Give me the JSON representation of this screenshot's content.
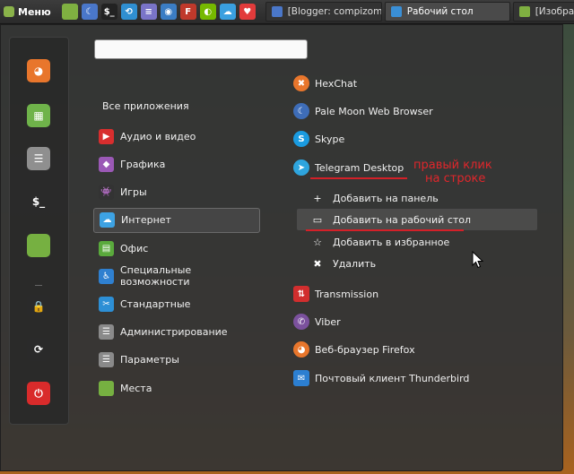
{
  "panel": {
    "menu_label": "Меню",
    "launchers": [
      {
        "icon": "folder-icon",
        "color": "#7fb041",
        "glyph": ""
      },
      {
        "icon": "pale-moon-icon",
        "color": "#4a77c9",
        "glyph": "☾"
      },
      {
        "icon": "terminal-icon",
        "color": "#222222",
        "glyph": "$_"
      },
      {
        "icon": "settings-icon",
        "color": "#2f8fd1",
        "glyph": "⟲"
      },
      {
        "icon": "notes-icon",
        "color": "#7a74c8",
        "glyph": "≡"
      },
      {
        "icon": "screenshot-icon",
        "color": "#3b7dc4",
        "glyph": "◉"
      },
      {
        "icon": "app-red-icon",
        "color": "#c0392b",
        "glyph": "F"
      },
      {
        "icon": "nvidia-icon",
        "color": "#76b900",
        "glyph": "◐"
      },
      {
        "icon": "weather-icon",
        "color": "#3aa0e0",
        "glyph": "☁"
      },
      {
        "icon": "heart-icon",
        "color": "#e23b3b",
        "glyph": "♥"
      }
    ],
    "tasks": [
      {
        "label": "[Blogger: compizoma…",
        "icon_color": "#4a77c9",
        "active": false
      },
      {
        "label": "Рабочий стол",
        "icon_color": "#3a8fd6",
        "active": true
      },
      {
        "label": "[Изобра",
        "icon_color": "#7fb041",
        "active": false
      }
    ]
  },
  "favorites": [
    {
      "icon": "firefox-icon",
      "color": "#e8762c",
      "glyph": "◕"
    },
    {
      "icon": "software-manager-icon",
      "color": "#6fb34a",
      "glyph": "▦"
    },
    {
      "icon": "settings-toggle-icon",
      "color": "#8f8f8f",
      "glyph": "☰"
    },
    {
      "icon": "terminal-icon",
      "color": "#2a2a2a",
      "glyph": "$_"
    },
    {
      "icon": "files-folder-icon",
      "color": "#76b041",
      "glyph": ""
    },
    {
      "icon": "lock-icon",
      "color": "#2a2a2a",
      "glyph": "🔒"
    },
    {
      "icon": "logout-icon",
      "color": "#2a2a2a",
      "glyph": "⟳"
    },
    {
      "icon": "power-icon",
      "color": "#d92b2b",
      "glyph": "⏻"
    }
  ],
  "search": {
    "value": "",
    "placeholder": ""
  },
  "categories_all": "Все приложения",
  "categories": [
    {
      "label": "Аудио и видео",
      "icon": "audio-video-icon",
      "color": "#d82e2e",
      "glyph": "▶",
      "selected": false
    },
    {
      "label": "Графика",
      "icon": "graphics-icon",
      "color": "#9b59b6",
      "glyph": "◆",
      "selected": false
    },
    {
      "label": "Игры",
      "icon": "games-icon",
      "color": "#333333",
      "glyph": "👾",
      "selected": false
    },
    {
      "label": "Интернет",
      "icon": "internet-icon",
      "color": "#3da2e3",
      "glyph": "☁",
      "selected": true
    },
    {
      "label": "Офис",
      "icon": "office-icon",
      "color": "#5aaa3c",
      "glyph": "▤",
      "selected": false
    },
    {
      "label": "Специальные возможности",
      "icon": "accessibility-icon",
      "color": "#2f80d0",
      "glyph": "♿",
      "selected": false
    },
    {
      "label": "Стандартные",
      "icon": "accessories-icon",
      "color": "#2d8fd5",
      "glyph": "✂",
      "selected": false
    },
    {
      "label": "Администрирование",
      "icon": "administration-icon",
      "color": "#8a8a8a",
      "glyph": "☰",
      "selected": false
    },
    {
      "label": "Параметры",
      "icon": "preferences-icon",
      "color": "#8a8a8a",
      "glyph": "☰",
      "selected": false
    },
    {
      "label": "Места",
      "icon": "places-folder-icon",
      "color": "#76b041",
      "glyph": "",
      "selected": false
    }
  ],
  "apps_top": [
    {
      "label": "HexChat",
      "icon": "hexchat-icon",
      "color": "#e8762c",
      "glyph": "✖"
    },
    {
      "label": "Pale Moon Web Browser",
      "icon": "pale-moon-icon",
      "color": "#3e6db8",
      "glyph": "☾"
    },
    {
      "label": "Skype",
      "icon": "skype-icon",
      "color": "#1a9be0",
      "glyph": "S"
    },
    {
      "label": "Telegram Desktop",
      "icon": "telegram-icon",
      "color": "#2ea5de",
      "glyph": "➤"
    }
  ],
  "context_menu": [
    {
      "label": "Добавить на панель",
      "icon": "plus-icon",
      "glyph": "+",
      "hover": false
    },
    {
      "label": "Добавить на рабочий стол",
      "icon": "desktop-icon",
      "glyph": "▭",
      "hover": true
    },
    {
      "label": "Добавить в избранное",
      "icon": "star-icon",
      "glyph": "☆",
      "hover": false
    },
    {
      "label": "Удалить",
      "icon": "remove-icon",
      "glyph": "✖",
      "hover": false
    }
  ],
  "apps_bottom": [
    {
      "label": "Transmission",
      "icon": "transmission-icon",
      "color": "#d12e2e",
      "glyph": "⇅"
    },
    {
      "label": "Viber",
      "icon": "viber-icon",
      "color": "#7b519d",
      "glyph": "✆"
    },
    {
      "label": "Веб-браузер Firefox",
      "icon": "firefox-icon",
      "color": "#e8762c",
      "glyph": "◕"
    },
    {
      "label": "Почтовый клиент Thunderbird",
      "icon": "thunderbird-icon",
      "color": "#2c7fd1",
      "glyph": "✉"
    }
  ],
  "annotation": {
    "line1": "правый клик",
    "line2": "на строке",
    "color": "#e0262b"
  }
}
